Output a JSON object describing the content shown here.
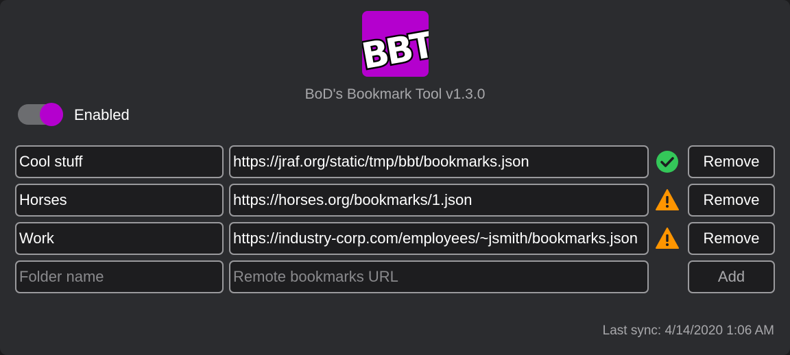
{
  "app": {
    "logo_text": "BBT",
    "title": "BoD's Bookmark Tool v1.3.0",
    "accent_color": "#b400ce"
  },
  "toggle": {
    "label": "Enabled",
    "checked": true
  },
  "bookmarks": [
    {
      "folder": "Cool stuff",
      "url": "https://jraf.org/static/tmp/bbt/bookmarks.json",
      "status": "check-circle-icon",
      "status_color": "#34c759",
      "action": "Remove"
    },
    {
      "folder": "Horses",
      "url": "https://horses.org/bookmarks/1.json",
      "status": "warning-icon",
      "status_color": "#ff9500",
      "action": "Remove"
    },
    {
      "folder": "Work",
      "url": "https://industry-corp.com/employees/~jsmith/bookmarks.json",
      "status": "warning-icon",
      "status_color": "#ff9500",
      "action": "Remove"
    }
  ],
  "new_row": {
    "folder_placeholder": "Folder name",
    "url_placeholder": "Remote bookmarks URL",
    "add_label": "Add"
  },
  "footer": {
    "last_sync_label": "Last sync:",
    "last_sync_value": "4/14/2020 1:06 AM"
  }
}
